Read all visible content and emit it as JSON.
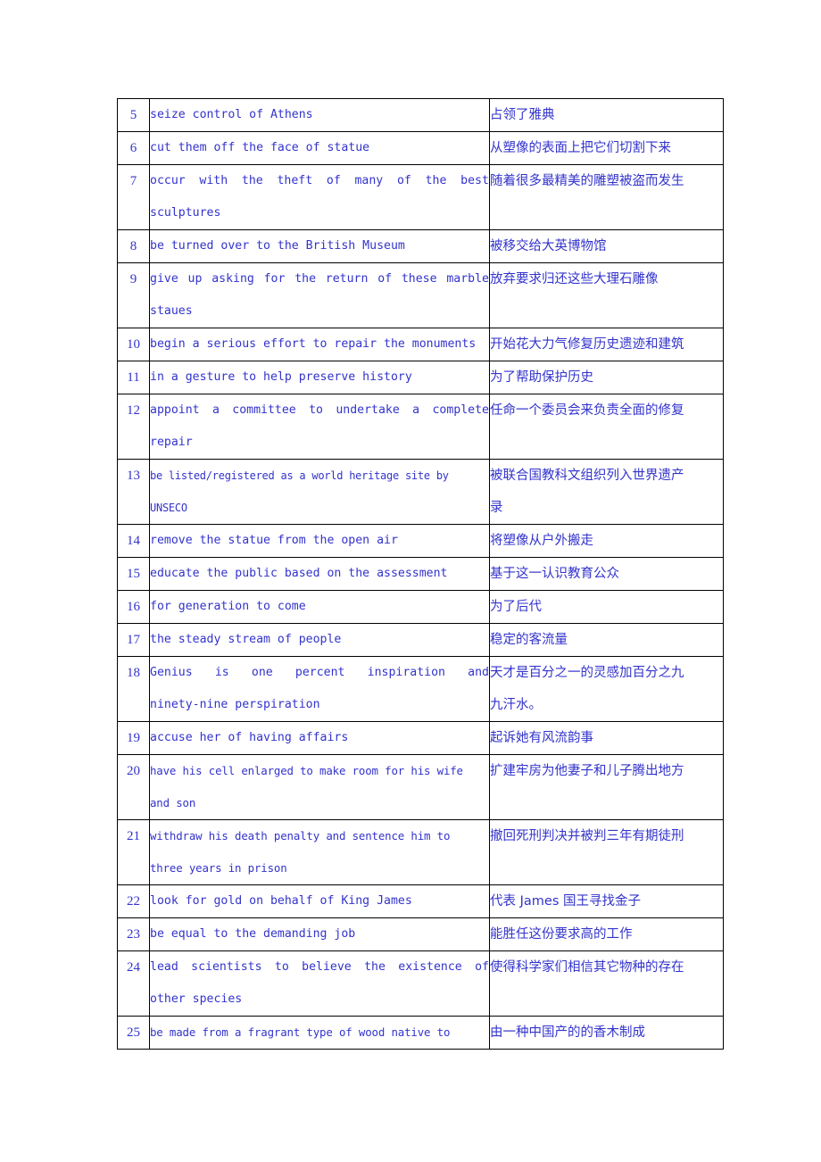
{
  "document": {
    "type": "vocabulary-translation-table",
    "text_color": "#3333cc",
    "border_color": "#000000",
    "background": "#ffffff",
    "columns": [
      "number",
      "english",
      "chinese"
    ]
  },
  "rows": [
    {
      "num": "5",
      "english_lines": [
        "seize control of Athens"
      ],
      "english": "seize control of Athens",
      "chinese_lines": [
        "占领了雅典"
      ],
      "lines": 1,
      "justified": false
    },
    {
      "num": "6",
      "english_lines": [
        "cut them off the face of statue"
      ],
      "english": "cut them off the face of statue",
      "chinese_lines": [
        "从塑像的表面上把它们切割下来"
      ],
      "lines": 1,
      "justified": false
    },
    {
      "num": "7",
      "english_lines": [
        "occur with the theft of many of the best",
        "sculptures"
      ],
      "english": "occur with the theft of many of the best sculptures",
      "chinese_lines": [
        "随着很多最精美的雕塑被盗而发生"
      ],
      "lines": 2,
      "justified": true,
      "justify_words": [
        "occur",
        "with",
        "the",
        "theft",
        "of",
        "many",
        "of",
        "the",
        "best"
      ]
    },
    {
      "num": "8",
      "english_lines": [
        "be turned over to the British Museum"
      ],
      "english": "be turned over to the British Museum",
      "chinese_lines": [
        "被移交给大英博物馆"
      ],
      "lines": 1,
      "justified": false
    },
    {
      "num": "9",
      "english_lines": [
        "give up asking for the return of these marble",
        "staues"
      ],
      "english": "give up asking for the return of these marble staues",
      "chinese_lines": [
        "放弃要求归还这些大理石雕像"
      ],
      "lines": 2,
      "justified": true,
      "justify_words": [
        "give",
        "up",
        "asking",
        "for",
        "the",
        "return",
        "of",
        "these",
        "marble"
      ]
    },
    {
      "num": "10",
      "english_lines": [
        "begin a serious effort to repair the monuments"
      ],
      "english": "begin a serious effort to repair the monuments",
      "chinese_lines": [
        "开始花大力气修复历史遗迹和建筑"
      ],
      "lines": 1,
      "justified": false
    },
    {
      "num": "11",
      "english_lines": [
        "in a gesture to help preserve history"
      ],
      "english": "in a gesture to help preserve history",
      "chinese_lines": [
        "为了帮助保护历史"
      ],
      "lines": 1,
      "justified": false
    },
    {
      "num": "12",
      "english_lines": [
        "appoint a committee to undertake a complete",
        "repair"
      ],
      "english": "appoint a committee to undertake a complete repair",
      "chinese_lines": [
        "任命一个委员会来负责全面的修复"
      ],
      "lines": 2,
      "justified": true,
      "justify_words": [
        "appoint",
        "a",
        "committee",
        "to",
        "undertake",
        "a",
        "complete"
      ]
    },
    {
      "num": "13",
      "english_lines": [
        "be listed/registered as a world heritage site by",
        "UNSECO"
      ],
      "english": "be listed/registered as a world heritage site by UNSECO",
      "chinese_lines": [
        "被联合国教科文组织列入世界遗产",
        "录"
      ],
      "lines": 2,
      "justified": false,
      "tight": 2
    },
    {
      "num": "14",
      "english_lines": [
        "remove the statue from the open air"
      ],
      "english": "remove the statue from the open air",
      "chinese_lines": [
        "将塑像从户外搬走"
      ],
      "lines": 1,
      "justified": false
    },
    {
      "num": "15",
      "english_lines": [
        "educate the public based on the assessment"
      ],
      "english": "educate the public based on the assessment",
      "chinese_lines": [
        "基于这一认识教育公众"
      ],
      "lines": 1,
      "justified": false
    },
    {
      "num": "16",
      "english_lines": [
        "for generation to come"
      ],
      "english": "for generation to come",
      "chinese_lines": [
        "为了后代"
      ],
      "lines": 1,
      "justified": false
    },
    {
      "num": "17",
      "english_lines": [
        "the steady stream of people"
      ],
      "english": "the steady stream of people",
      "chinese_lines": [
        "稳定的客流量"
      ],
      "lines": 1,
      "justified": false
    },
    {
      "num": "18",
      "english_lines": [
        "Genius is one percent inspiration and",
        "ninety-nine perspiration"
      ],
      "english": "Genius is one percent inspiration and ninety-nine perspiration",
      "chinese_lines": [
        "天才是百分之一的灵感加百分之九",
        "九汗水。"
      ],
      "lines": 2,
      "justified": true,
      "justify_words": [
        "Genius",
        "is",
        "one",
        "percent",
        "inspiration",
        "and"
      ]
    },
    {
      "num": "19",
      "english_lines": [
        "accuse her of having affairs"
      ],
      "english": "accuse her of having affairs",
      "chinese_lines": [
        "起诉她有风流韵事"
      ],
      "lines": 1,
      "justified": false
    },
    {
      "num": "20",
      "english_lines": [
        "have his cell enlarged to make room for his wife",
        "and son"
      ],
      "english": "have his cell enlarged to make room for his wife and son",
      "chinese_lines": [
        "扩建牢房为他妻子和儿子腾出地方"
      ],
      "lines": 2,
      "justified": false,
      "tight": 1
    },
    {
      "num": "21",
      "english_lines": [
        "withdraw his death penalty and sentence him to",
        "three years in prison"
      ],
      "english": "withdraw his death penalty and sentence him to three years in prison",
      "chinese_lines": [
        "撤回死刑判决并被判三年有期徒刑"
      ],
      "lines": 2,
      "justified": false,
      "tight": 1
    },
    {
      "num": "22",
      "english_lines": [
        "look for gold on behalf of King James"
      ],
      "english": "look for gold on behalf of King James",
      "chinese_lines": [
        "代表 James 国王寻找金子"
      ],
      "lines": 1,
      "justified": false
    },
    {
      "num": "23",
      "english_lines": [
        "be equal to the demanding job"
      ],
      "english": "be equal to the demanding job",
      "chinese_lines": [
        "能胜任这份要求高的工作"
      ],
      "lines": 1,
      "justified": false
    },
    {
      "num": "24",
      "english_lines": [
        "lead scientists to believe the existence of",
        "other species"
      ],
      "english": "lead scientists to believe the existence of other species",
      "chinese_lines": [
        "使得科学家们相信其它物种的存在"
      ],
      "lines": 2,
      "justified": true,
      "justify_words": [
        "lead",
        "scientists",
        "to",
        "believe",
        "the",
        "existence",
        "of"
      ]
    },
    {
      "num": "25",
      "english_lines": [
        "be made from a fragrant type of wood native to"
      ],
      "english": "be made from a fragrant type of wood native to",
      "chinese_lines": [
        "由一种中国产的的香木制成"
      ],
      "lines": 1,
      "justified": false,
      "tight": 1
    }
  ]
}
